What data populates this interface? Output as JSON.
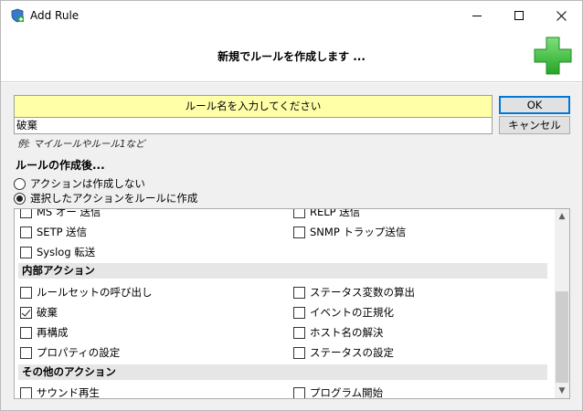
{
  "window": {
    "title": "Add Rule",
    "icon": "app-shield-icon"
  },
  "header": {
    "text": "新規でルールを作成します ...",
    "icon": "green-plus-icon",
    "accent": "#3cc23c"
  },
  "name_section": {
    "label": "ルール名を入力してください",
    "value": "破棄",
    "example": "例: マイルールやルール1など"
  },
  "buttons": {
    "ok": "OK",
    "cancel": "キャンセル"
  },
  "after_create": {
    "title": "ルールの作成後...",
    "options": [
      {
        "label": "アクションは作成しない",
        "checked": false
      },
      {
        "label": "選択したアクションをルールに作成",
        "checked": true
      }
    ]
  },
  "actions": {
    "partial_row": {
      "left": "MS オー 送信",
      "right": "RELP 送信"
    },
    "row_setp": {
      "left": "SETP 送信",
      "right": "SNMP トラップ送信"
    },
    "row_syslog": {
      "left": "Syslog 転送"
    },
    "group_internal": "内部アクション",
    "internal": [
      {
        "left": "ルールセットの呼び出し",
        "left_checked": false,
        "right": "ステータス変数の算出",
        "right_checked": false
      },
      {
        "left": "破棄",
        "left_checked": true,
        "right": "イベントの正規化",
        "right_checked": false
      },
      {
        "left": "再構成",
        "left_checked": false,
        "right": "ホスト名の解決",
        "right_checked": false
      },
      {
        "left": "プロパティの設定",
        "left_checked": false,
        "right": "ステータスの設定",
        "right_checked": false
      }
    ],
    "group_other": "その他のアクション",
    "other": [
      {
        "left": "サウンド再生",
        "left_checked": false,
        "right": "プログラム開始",
        "right_checked": false
      }
    ]
  },
  "colors": {
    "name_label_bg": "#ffffa8",
    "ok_border": "#0078d7"
  }
}
